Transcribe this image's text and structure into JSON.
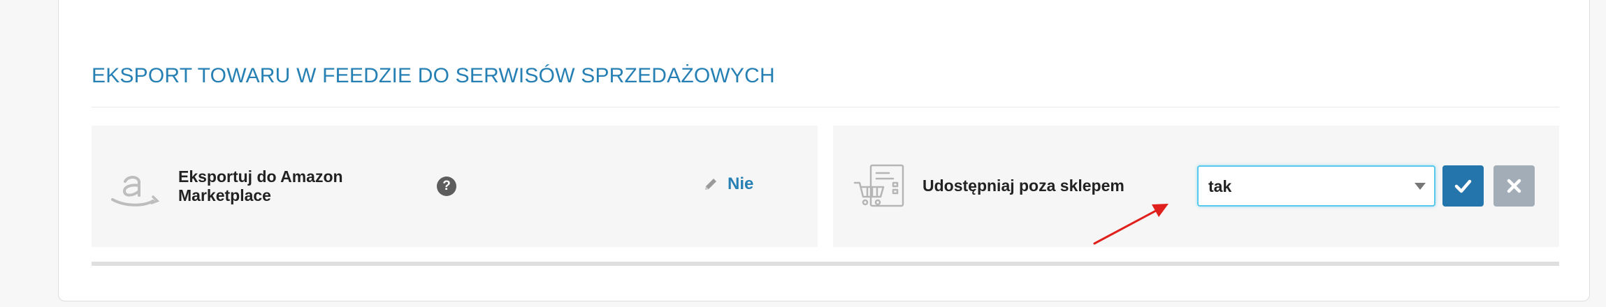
{
  "section": {
    "title": "EKSPORT TOWARU W FEEDZIE DO SERWISÓW SPRZEDAŻOWYCH"
  },
  "left_panel": {
    "label": "Eksportuj do Amazon Marketplace",
    "help_glyph": "?",
    "value": "Nie",
    "icon": "amazon-icon"
  },
  "right_panel": {
    "label": "Udostępniaj poza sklepem",
    "select_value": "tak",
    "icon": "store-share-icon",
    "confirm_icon": "check-icon",
    "cancel_icon": "close-icon"
  },
  "colors": {
    "accent": "#2780b4",
    "confirm": "#2575ad",
    "cancel": "#a2adb8",
    "focus_border": "#58c9ec",
    "annotation_arrow": "#e0201c"
  }
}
